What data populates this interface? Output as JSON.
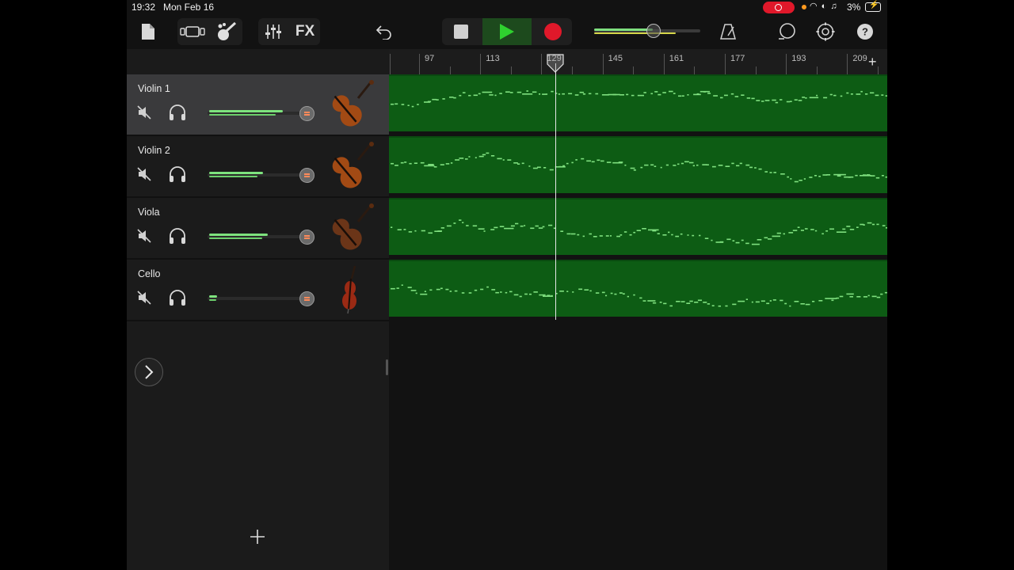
{
  "status_bar": {
    "time": "19:32",
    "date": "Mon Feb 16",
    "battery": "3%"
  },
  "toolbar": {
    "fx_label": "FX"
  },
  "ruler": {
    "bars": [
      "97",
      "113",
      "129",
      "145",
      "161",
      "177",
      "193",
      "209"
    ]
  },
  "tracks": [
    {
      "name": "Violin 1",
      "volume": 0.75,
      "selected": true
    },
    {
      "name": "Violin 2",
      "volume": 0.55,
      "selected": false
    },
    {
      "name": "Viola",
      "volume": 0.6,
      "selected": false
    },
    {
      "name": "Cello",
      "volume": 0.08,
      "selected": false
    }
  ],
  "master_volume": 0.55,
  "colors": {
    "region": "#0d5c14",
    "notes": "#7fe07f",
    "record": "#e0182a",
    "play": "#2fd12f"
  }
}
